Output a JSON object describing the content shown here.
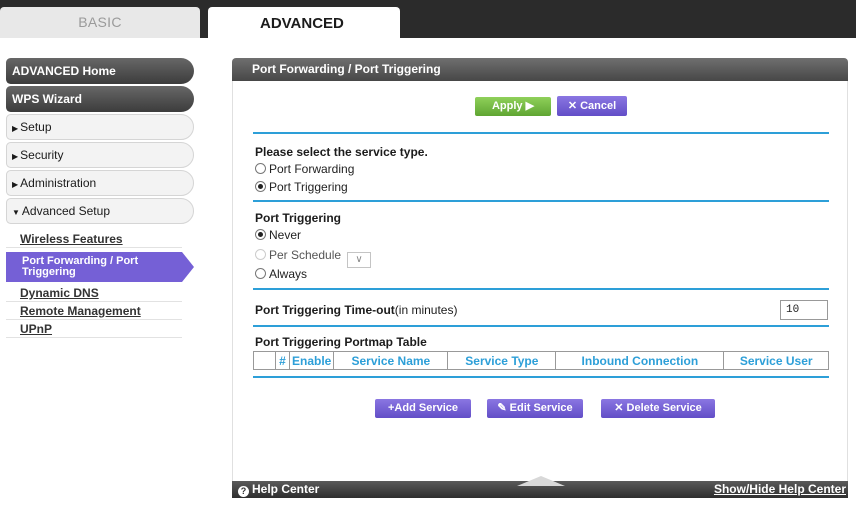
{
  "tabs": {
    "basic": "BASIC",
    "advanced": "ADVANCED"
  },
  "sidebar": {
    "home": "ADVANCED Home",
    "wps": "WPS Wizard",
    "setup": "Setup",
    "security": "Security",
    "administration": "Administration",
    "advanced_setup": "Advanced Setup",
    "sub_items": {
      "wireless": "Wireless Features",
      "port_fwd": "Port Forwarding / Port Triggering",
      "ddns": "Dynamic DNS",
      "remote": "Remote Management",
      "upnp": "UPnP"
    }
  },
  "panel": {
    "title": "Port Forwarding / Port Triggering",
    "apply": "Apply ▶",
    "cancel": "Cancel",
    "service_type": {
      "heading": "Please select the service type.",
      "opt_forwarding": "Port Forwarding",
      "opt_triggering": "Port Triggering",
      "selected": "Port Triggering"
    },
    "triggering": {
      "heading": "Port Triggering",
      "never": "Never",
      "per_schedule": "Per Schedule",
      "always": "Always",
      "selected": "Never"
    },
    "timeout": {
      "label": "Port Triggering Time-out",
      "unit": "(in minutes)",
      "value": "10"
    },
    "portmap": {
      "heading": "Port Triggering Portmap Table",
      "columns": [
        "#",
        "Enable",
        "Service Name",
        "Service Type",
        "Inbound Connection",
        "Service User"
      ]
    },
    "actions": {
      "add": "Add Service",
      "edit": "Edit Service",
      "delete": "Delete Service"
    }
  },
  "helpbar": {
    "left": "Help Center",
    "right": "Show/Hide Help Center"
  },
  "colors": {
    "accent_blue": "#2d9fd8",
    "purple": "#7560d6",
    "green": "#6cb33e"
  }
}
